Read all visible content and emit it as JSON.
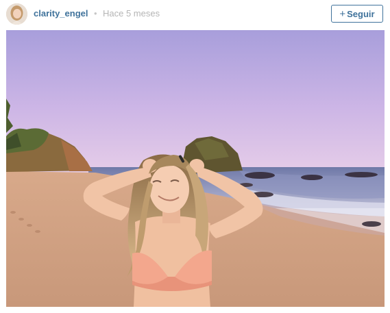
{
  "post": {
    "username": "clarity_engel",
    "separator": "•",
    "timestamp": "Hace 5 meses",
    "follow_button": {
      "icon": "plus-icon",
      "plus_glyph": "+",
      "label": "Seguir"
    }
  },
  "colors": {
    "username": "#3f729b",
    "timestamp": "#b5b5b5",
    "follow_border": "#3f729b",
    "sky_top": "#a89edb",
    "sky_bottom": "#e6cde8",
    "sand": "#cf9f82"
  }
}
